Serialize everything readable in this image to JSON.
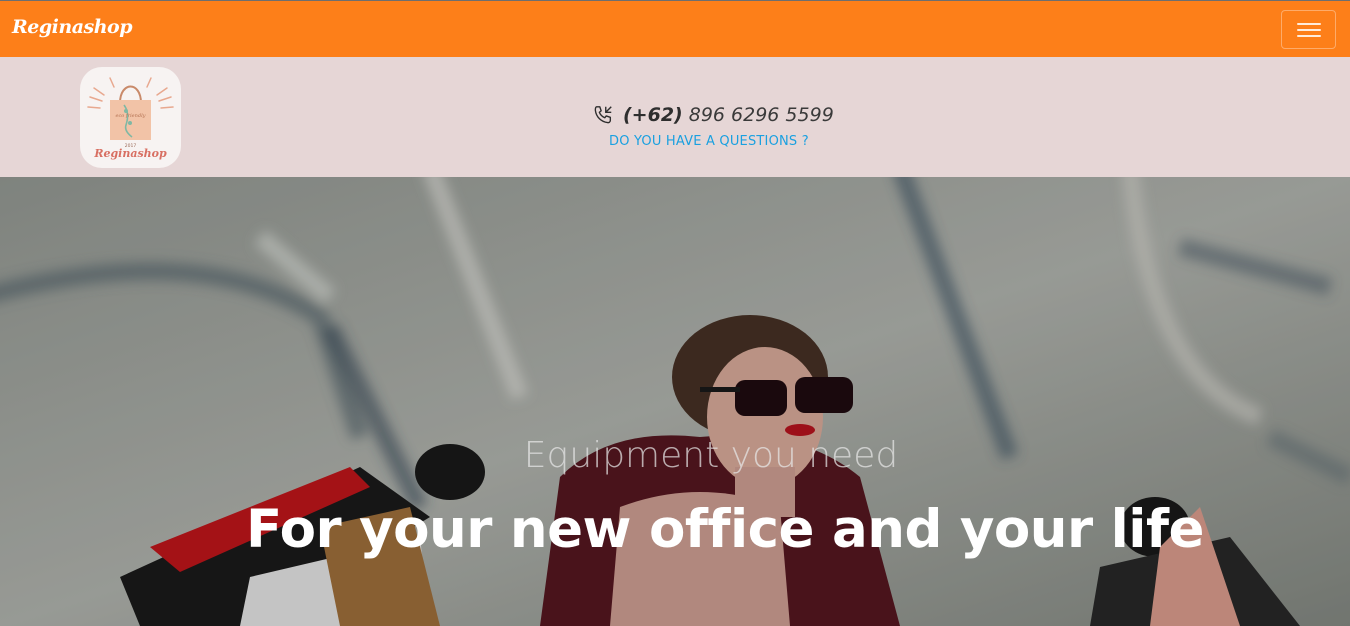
{
  "navbar": {
    "brand": "Reginashop",
    "toggle_icon": "hamburger-menu-icon",
    "background": "#fd7f19"
  },
  "contact": {
    "logo": {
      "brand_script": "Reginashop",
      "tagline": "eco friendly",
      "year": "2017"
    },
    "phone_icon": "phone-call-icon",
    "phone_code": "(+62)",
    "phone_number": "896 6296 5599",
    "question": "DO YOU HAVE A QUESTIONS ?",
    "background": "#e6d6d6",
    "link_color": "#1aa0e0"
  },
  "hero": {
    "subtitle": "Equipment you need",
    "title": "For your new office and your life"
  }
}
